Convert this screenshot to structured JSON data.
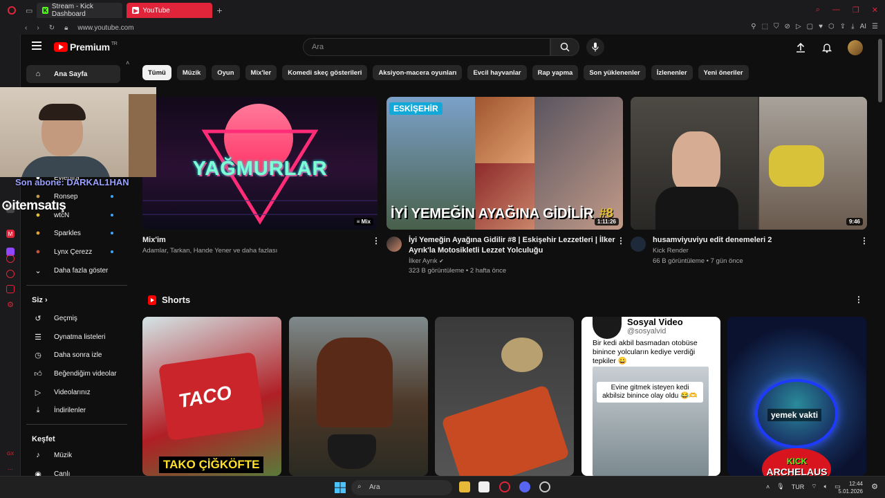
{
  "browser": {
    "tabs": [
      {
        "label": "Stream - Kick Dashboard"
      },
      {
        "label": "YouTube"
      }
    ],
    "url": "www.youtube.com",
    "ai_label": "AI"
  },
  "header": {
    "logo": "Premium",
    "logo_region": "TR",
    "search_placeholder": "Ara"
  },
  "guide": {
    "home": "Ana Sayfa",
    "subscriptions": [
      {
        "label": "Evientra"
      },
      {
        "label": "Ronsep"
      },
      {
        "label": "wtcN"
      },
      {
        "label": "Sparkles"
      },
      {
        "label": "Lynx Çerezz"
      }
    ],
    "show_more": "Daha fazla göster",
    "you_section": "Siz",
    "you_items": [
      {
        "label": "Geçmiş"
      },
      {
        "label": "Oynatma listeleri"
      },
      {
        "label": "Daha sonra izle"
      },
      {
        "label": "Beğendiğim videolar"
      },
      {
        "label": "Videolarınız"
      },
      {
        "label": "İndirilenler"
      }
    ],
    "explore_section": "Keşfet",
    "explore_items": [
      {
        "label": "Müzik"
      },
      {
        "label": "Canlı"
      }
    ]
  },
  "chips": [
    "Tümü",
    "Müzik",
    "Oyun",
    "Mix'ler",
    "Komedi skeç gösterileri",
    "Aksiyon-macera oyunları",
    "Evcil hayvanlar",
    "Rap yapma",
    "Son yüklenenler",
    "İzlenenler",
    "Yeni öneriler"
  ],
  "videos": [
    {
      "title": "Mix'im",
      "meta": "Adamlar, Tarkan, Hande Yener ve daha fazlası",
      "thumb_text": "YAĞMURLAR",
      "badge": "Mix"
    },
    {
      "title_line1": "İyi Yemeğin Ayağına Gidilir #8 | Eskişehir Lezzetleri | İlker",
      "title_line2": "Ayrık'la Motosikletli Lezzet Yolculuğu",
      "channel": "İlker Ayrık",
      "meta": "323 B görüntüleme • 2 hafta önce",
      "thumb_text": "İYİ YEMEĞİN AYAĞINA GİDİLİR",
      "thumb_tag": "ESKİŞEHİR",
      "thumb_num": "#8",
      "duration": "1:11:26"
    },
    {
      "title": "husamviyuviyu edit denemeleri 2",
      "channel": "Kick Render",
      "meta": "66 B görüntüleme • 7 gün önce",
      "duration": "9:46"
    }
  ],
  "shorts": {
    "title": "Shorts",
    "items": [
      {
        "caption": "TAKO ÇİĞKÖFTE",
        "brand": "TACO"
      },
      {
        "caption": ""
      },
      {
        "caption": ""
      },
      {
        "caption_head": "Sosyal Video",
        "caption_handle": "@sosyalvid",
        "caption_body": "Bir kedi akbil basmadan otobüse binince yolcuların kediye verdiği tepkiler 😀",
        "inner_caption": "Evine gitmek isteyen kedi akbilsiz binince olay oldu 😂🫶"
      },
      {
        "caption": "yemek vakti",
        "brand_line1": "KICK",
        "brand_line2": "ARCHELAUS"
      }
    ]
  },
  "stream_overlay": {
    "sub_text": "Son abone: DARKAL1HAN",
    "sponsor": "itemsatış"
  },
  "taskbar": {
    "search": "Ara",
    "lang": "TUR",
    "time": "12:44",
    "date": "5.01.2026"
  }
}
